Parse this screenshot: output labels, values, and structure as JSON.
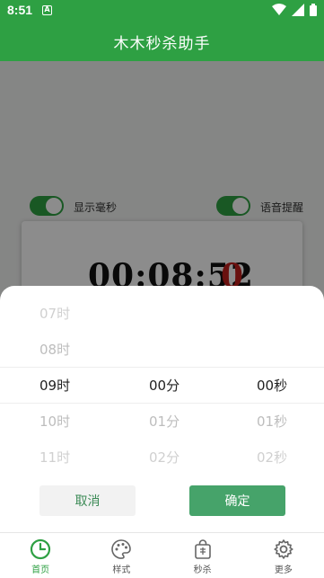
{
  "status_bar": {
    "time": "8:51",
    "notification_badge": "A"
  },
  "app": {
    "title": "木木秒杀助手"
  },
  "toggles": [
    {
      "label": "显示毫秒",
      "on": true
    },
    {
      "label": "语音提醒",
      "on": true
    }
  ],
  "clock": {
    "time": "00:08:52",
    "millis": "0"
  },
  "picker": {
    "rows": [
      {
        "hour": "07时",
        "minute": "",
        "second": ""
      },
      {
        "hour": "08时",
        "minute": "",
        "second": ""
      },
      {
        "hour": "09时",
        "minute": "00分",
        "second": "00秒"
      },
      {
        "hour": "10时",
        "minute": "01分",
        "second": "01秒"
      },
      {
        "hour": "11时",
        "minute": "02分",
        "second": "02秒"
      }
    ],
    "cancel_label": "取消",
    "confirm_label": "确定"
  },
  "bottom_nav": [
    {
      "label": "首页",
      "icon": "clock-icon",
      "active": true
    },
    {
      "label": "样式",
      "icon": "palette-icon",
      "active": false
    },
    {
      "label": "秒杀",
      "icon": "bag-icon",
      "active": false
    },
    {
      "label": "更多",
      "icon": "gear-icon",
      "active": false
    }
  ],
  "colors": {
    "primary": "#2ea043",
    "confirm": "#46a36a",
    "millis": "#c0201c"
  }
}
